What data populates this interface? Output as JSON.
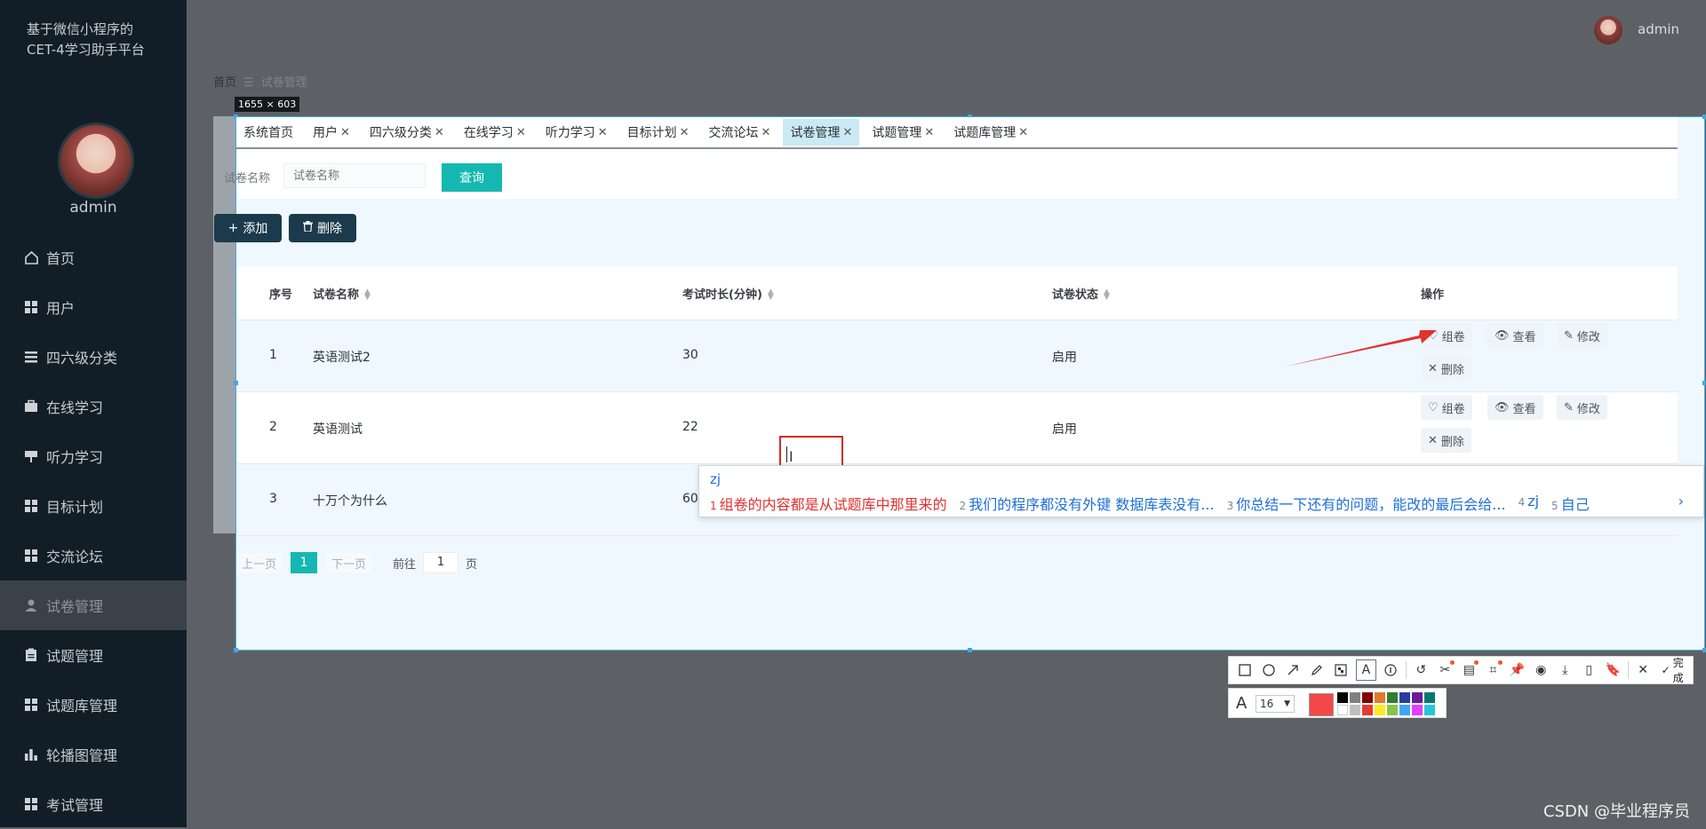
{
  "app": {
    "title_line1": "基于微信小程序的",
    "title_line2": "CET-4学习助手平台"
  },
  "sidebar": {
    "username": "admin",
    "items": [
      {
        "label": "首页",
        "icon": "home-icon"
      },
      {
        "label": "用户",
        "icon": "grid-icon"
      },
      {
        "label": "四六级分类",
        "icon": "list-icon"
      },
      {
        "label": "在线学习",
        "icon": "briefcase-icon"
      },
      {
        "label": "听力学习",
        "icon": "flag-icon"
      },
      {
        "label": "目标计划",
        "icon": "grid-icon"
      },
      {
        "label": "交流论坛",
        "icon": "grid-icon"
      },
      {
        "label": "试卷管理",
        "icon": "user-icon",
        "active": true
      },
      {
        "label": "试题管理",
        "icon": "clipboard-icon"
      },
      {
        "label": "试题库管理",
        "icon": "grid-icon"
      },
      {
        "label": "轮播图管理",
        "icon": "bar-chart-icon"
      },
      {
        "label": "考试管理",
        "icon": "grid-icon"
      }
    ]
  },
  "header": {
    "username": "admin"
  },
  "breadcrumb": {
    "home": "首页",
    "sep": "☰",
    "current": "试卷管理"
  },
  "selection_label": "1655 × 603",
  "tabs": [
    {
      "label": "系统首页",
      "closable": false
    },
    {
      "label": "用户",
      "closable": true
    },
    {
      "label": "四六级分类",
      "closable": true
    },
    {
      "label": "在线学习",
      "closable": true
    },
    {
      "label": "听力学习",
      "closable": true
    },
    {
      "label": "目标计划",
      "closable": true
    },
    {
      "label": "交流论坛",
      "closable": true
    },
    {
      "label": "试卷管理",
      "closable": true,
      "active": true
    },
    {
      "label": "试题管理",
      "closable": true
    },
    {
      "label": "试题库管理",
      "closable": true
    }
  ],
  "search": {
    "label": "试卷名称",
    "placeholder": "试卷名称",
    "button": "查询"
  },
  "actions": {
    "add": "添加",
    "delete": "删除"
  },
  "table": {
    "headers": {
      "index": "序号",
      "name": "试卷名称",
      "duration": "考试时长(分钟)",
      "status": "试卷状态",
      "ops": "操作"
    },
    "rows": [
      {
        "index": "1",
        "name": "英语测试2",
        "duration": "30",
        "status": "启用"
      },
      {
        "index": "2",
        "name": "英语测试",
        "duration": "22",
        "status": "启用"
      },
      {
        "index": "3",
        "name": "十万个为什么",
        "duration": "60",
        "status": ""
      }
    ],
    "ops": {
      "compose": "组卷",
      "view": "查看",
      "edit": "修改",
      "delete": "删除"
    }
  },
  "pager": {
    "prev": "上一页",
    "page": "1",
    "next": "下一页",
    "goto": "前往",
    "goto_value": "1",
    "unit": "页"
  },
  "ime": {
    "composition": "zj",
    "candidates": [
      {
        "n": "1",
        "text": "组卷的内容都是从试题库中那里来的"
      },
      {
        "n": "2",
        "text": "我们的程序都没有外键  数据库表没有..."
      },
      {
        "n": "3",
        "text": "你总结一下还有的问题，能改的最后会给..."
      },
      {
        "n": "4",
        "text": "zj"
      },
      {
        "n": "5",
        "text": "自己"
      }
    ],
    "next": "›"
  },
  "screenshot_toolbar": {
    "done": "完成",
    "font_size": "16"
  },
  "colors": {
    "accent": "#14b8b0",
    "sidebar_bg": "#121e27",
    "annotation_red": "#e2312e",
    "selection_blue": "#40a7e3"
  },
  "watermark": "CSDN @毕业程序员"
}
